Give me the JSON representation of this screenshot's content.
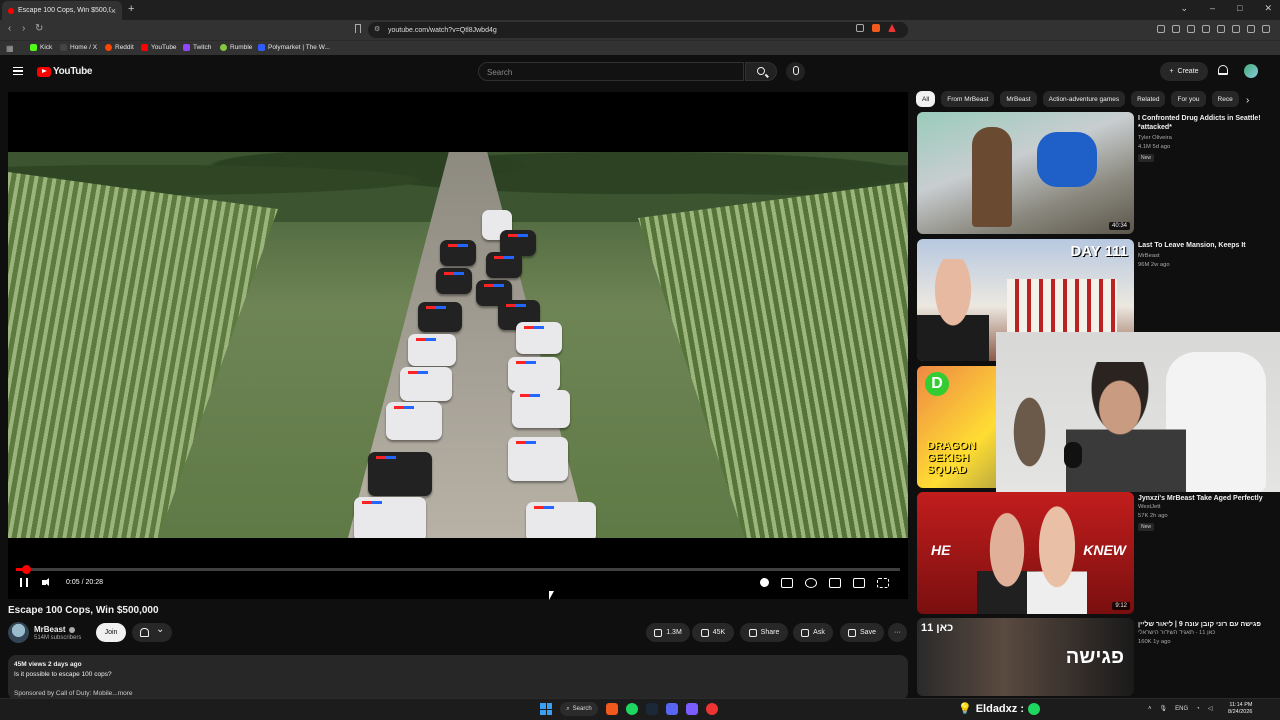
{
  "browser": {
    "tab_title": "Escape 100 Cops, Win $500,0",
    "new_tab": "+",
    "address": "youtube.com/watch?v=Qtl8Jwbd4g",
    "bookmarks": [
      {
        "label": "Kick",
        "color": "#53fc18"
      },
      {
        "label": "Home / X",
        "color": "#444444"
      },
      {
        "label": "Reddit",
        "color": "#ff4500"
      },
      {
        "label": "YouTube",
        "color": "#ff0000"
      },
      {
        "label": "Twitch",
        "color": "#9146ff"
      },
      {
        "label": "Rumble",
        "color": "#85c742"
      },
      {
        "label": "Polymarket | The W...",
        "color": "#2e5cff"
      }
    ]
  },
  "youtube": {
    "logo_text": "YouTube",
    "search_placeholder": "Search",
    "create_label": "Create",
    "player": {
      "time": "0:05 / 20:28",
      "progress": 0.004
    },
    "video": {
      "title": "Escape 100 Cops, Win $500,000",
      "channel": "MrBeast",
      "subscribers": "514M subscribers",
      "join": "Join",
      "likes": "1.3M",
      "dislikes": "45K",
      "share": "Share",
      "ask": "Ask",
      "save": "Save",
      "more": "···",
      "desc_line1": "45M views  2 days ago",
      "desc_line2": "Is it possible to escape 100 cops?",
      "desc_line3": "Sponsored by Call of Duty: Mobile...more"
    },
    "chips": [
      "All",
      "From MrBeast",
      "MrBeast",
      "Action-adventure games",
      "Related",
      "For you",
      "Rece"
    ],
    "recommendations": [
      {
        "title": "I Confronted Drug Addicts in Seattle! *attacked*",
        "channel": "Tyler Oliveira",
        "stats": "4.1M  5d ago",
        "badge": "New",
        "duration": "40:34"
      },
      {
        "title": "Last To Leave Mansion, Keeps It",
        "channel": "MrBeast",
        "stats": "96M  2w ago",
        "badge": "",
        "duration": "",
        "overlay": "DAY 111"
      },
      {
        "title": "",
        "channel": "",
        "stats": "",
        "badge": "",
        "duration": "",
        "overlay": "DRAGON GEKISH SQUAD"
      },
      {
        "title": "Jynxzi's MrBeast Take Aged Perfectly",
        "channel": "WestJett",
        "stats": "57K  2h ago",
        "badge": "New",
        "duration": "9:12",
        "overlay_left": "HE",
        "overlay_right": "KNEW"
      },
      {
        "title": "פגישה עם רוני קובן עונה 9 | ליאור שליין",
        "channel": "כאן 11 - תאגיד השידור הישראלי",
        "stats": "160K  1y ago",
        "badge": "",
        "duration": "",
        "overlay_left": "כאן 11",
        "overlay_right": "פגישה"
      }
    ]
  },
  "taskbar": {
    "search": "Search",
    "stream_text": "Eldadxz :",
    "lang": "ENG",
    "time": "11:14 PM",
    "date": "8/24/2026"
  }
}
